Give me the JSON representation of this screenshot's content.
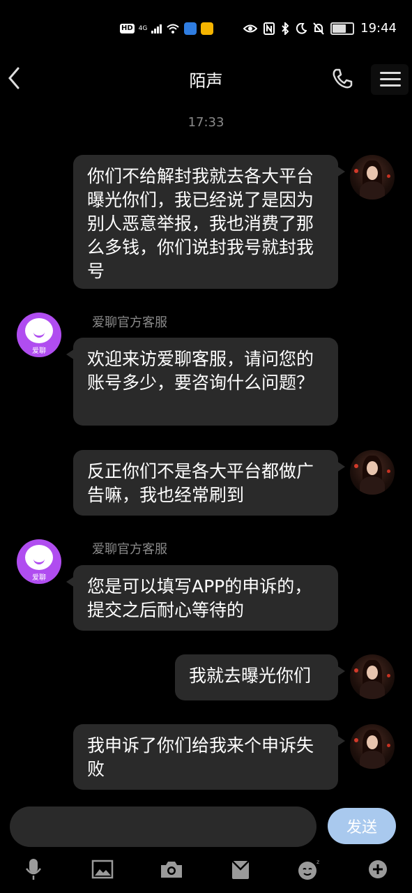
{
  "status_bar": {
    "hd": "HD",
    "network": "4G",
    "time": "19:44"
  },
  "nav": {
    "title": "陌声"
  },
  "timestamp": "17:33",
  "messages": [
    {
      "side": "out",
      "text": "你们不给解封我就去各大平台曝光你们，我已经说了是因为别人恶意举报，我也消费了那么多钱，你们说封我号就封我号"
    },
    {
      "side": "in",
      "sender": "爱聊官方客服",
      "text": "欢迎来访爱聊客服，请问您的账号多少，要咨询什么问题？"
    },
    {
      "side": "out",
      "text": "反正你们不是各大平台都做广告嘛，我也经常刷到"
    },
    {
      "side": "in",
      "sender": "爱聊官方客服",
      "text": "您是可以填写APP的申诉的，提交之后耐心等待的"
    },
    {
      "side": "out",
      "text": "我就去曝光你们"
    },
    {
      "side": "out",
      "text": "我申诉了你们给我来个申诉失败"
    }
  ],
  "bot_avatar_label": "爱聊",
  "input": {
    "placeholder": "",
    "send_label": "发送"
  },
  "toolbar": {
    "icons": [
      "microphone-icon",
      "image-icon",
      "camera-icon",
      "gift-icon",
      "emoji-icon",
      "plus-icon"
    ]
  },
  "colors": {
    "background": "#000000",
    "bubble": "#2a2a2a",
    "send_button": "#a9c9ee",
    "bot_avatar": "#b04df0",
    "muted_text": "#8a8a8a"
  }
}
